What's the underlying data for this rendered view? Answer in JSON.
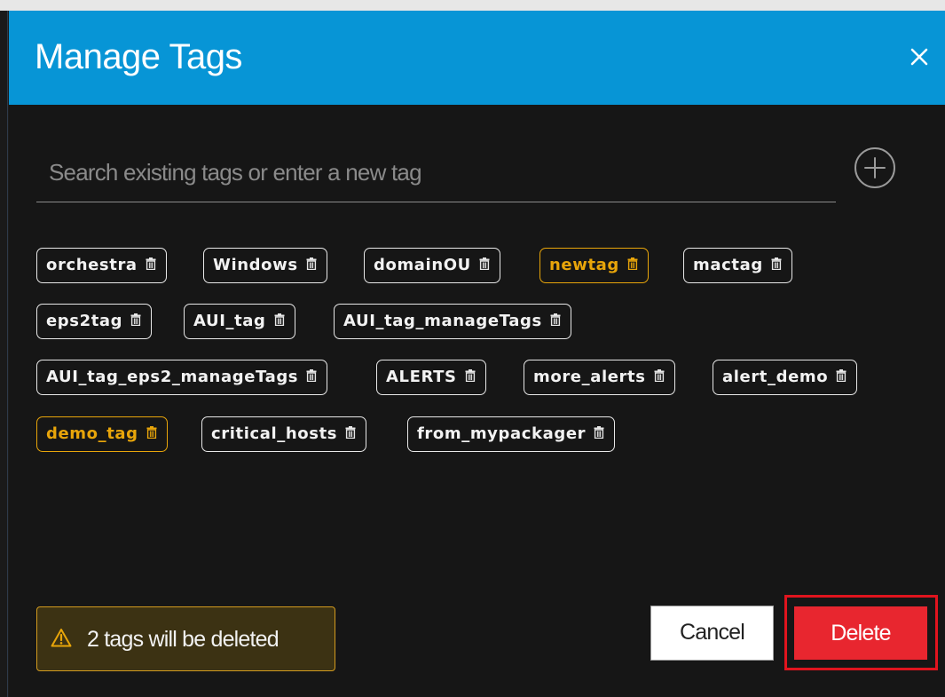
{
  "dialog": {
    "title": "Manage Tags",
    "close_icon": "close-icon"
  },
  "search": {
    "placeholder": "Search existing tags or enter a new tag",
    "value": "",
    "add_icon": "plus-circle-icon"
  },
  "tags": [
    {
      "label": "orchestra",
      "selected": false
    },
    {
      "label": "Windows",
      "selected": false
    },
    {
      "label": "domainOU",
      "selected": false
    },
    {
      "label": "newtag",
      "selected": true
    },
    {
      "label": "mactag",
      "selected": false
    },
    {
      "label": "eps2tag",
      "selected": false
    },
    {
      "label": "AUI_tag",
      "selected": false
    },
    {
      "label": "AUI_tag_manageTags",
      "selected": false
    },
    {
      "label": "AUI_tag_eps2_manageTags",
      "selected": false
    },
    {
      "label": "ALERTS",
      "selected": false
    },
    {
      "label": "more_alerts",
      "selected": false
    },
    {
      "label": "alert_demo",
      "selected": false
    },
    {
      "label": "demo_tag",
      "selected": true
    },
    {
      "label": "critical_hosts",
      "selected": false
    },
    {
      "label": "from_mypackager",
      "selected": false
    }
  ],
  "tag_icon": "trash-icon",
  "footer": {
    "warning_icon": "warning-icon",
    "warning_text": "2 tags will be deleted",
    "cancel_label": "Cancel",
    "delete_label": "Delete"
  },
  "colors": {
    "header": "#0795d6",
    "selected_tag": "#e8a50a",
    "delete": "#e8262f"
  }
}
